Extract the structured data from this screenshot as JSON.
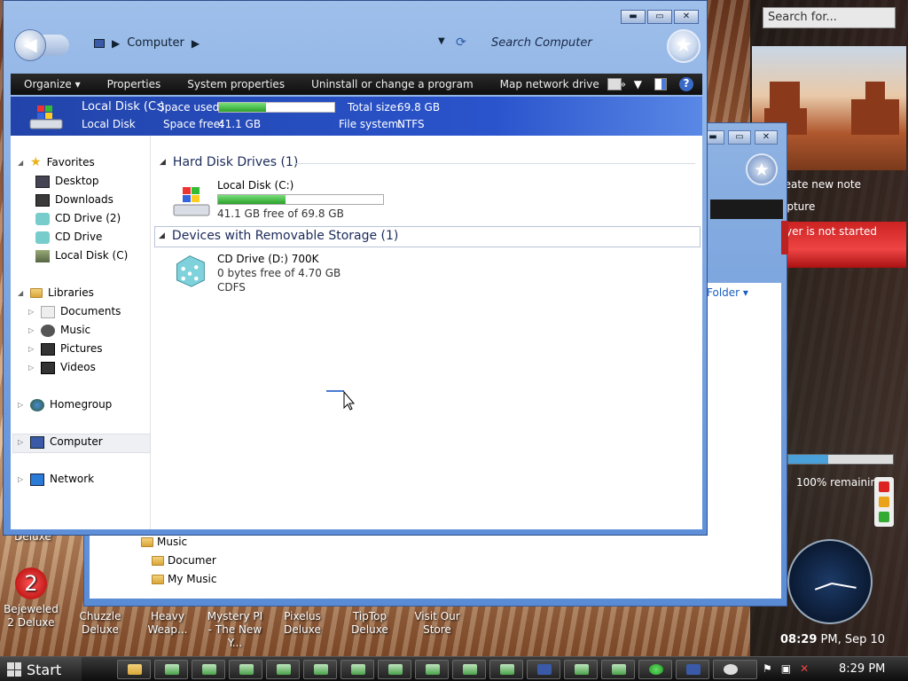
{
  "main_window": {
    "breadcrumb": [
      "Computer"
    ],
    "search_placeholder": "Search Computer",
    "window_controls": {
      "minimize": "▬",
      "maximize": "▭",
      "close": "✕"
    },
    "toolbar": {
      "organize": "Organize ▾",
      "properties": "Properties",
      "system_properties": "System properties",
      "uninstall": "Uninstall or change a program",
      "map_drive": "Map network drive",
      "more": "»"
    },
    "details": {
      "drive_name": "Local Disk (C:)",
      "drive_type": "Local Disk",
      "space_used_label": "Space used:",
      "space_used_fraction": 0.41,
      "space_free_label": "Space free:",
      "space_free_value": "41.1 GB",
      "total_size_label": "Total size:",
      "total_size_value": "69.8 GB",
      "file_system_label": "File system:",
      "file_system_value": "NTFS"
    },
    "nav": {
      "favorites": "Favorites",
      "desktop": "Desktop",
      "downloads": "Downloads",
      "cd_drive_2": "CD Drive (2)",
      "cd_drive": "CD Drive",
      "local_disk": "Local Disk (C)",
      "libraries": "Libraries",
      "documents": "Documents",
      "music": "Music",
      "pictures": "Pictures",
      "videos": "Videos",
      "homegroup": "Homegroup",
      "computer": "Computer",
      "network": "Network"
    },
    "groups": {
      "hard_disk": "Hard Disk Drives (1)",
      "removable": "Devices with Removable Storage (1)"
    },
    "local_disk_item": {
      "name": "Local Disk (C:)",
      "free_text": "41.1 GB free of 69.8 GB",
      "used_fraction": 0.41
    },
    "cd_item": {
      "name": "CD Drive (D:) 700K",
      "free_text": "0 bytes free of 4.70 GB",
      "fs": "CDFS"
    }
  },
  "back_window": {
    "folder_link": "Folder ▾",
    "tree": [
      "Music",
      "Documer",
      "My Music"
    ]
  },
  "gadgets": {
    "search_placeholder": "Search for...",
    "notes": [
      "reate new note",
      "apture"
    ],
    "media": "yer is not started",
    "battery": "100% remaining",
    "clock_time": "08:29",
    "clock_suffix": "PM, Sep 10"
  },
  "desktop_icons": [
    {
      "label": "Deluxe"
    },
    {
      "label": "Bejeweled 2 Deluxe"
    },
    {
      "label": "Chuzzle Deluxe"
    },
    {
      "label": "Heavy Weap..."
    },
    {
      "label": "Mystery PI - The New Y..."
    },
    {
      "label": "Pixelus Deluxe"
    },
    {
      "label": "TipTop Deluxe"
    },
    {
      "label": "Visit Our Store"
    }
  ],
  "taskbar": {
    "start_label": "Start",
    "time": "8:29 PM"
  },
  "colors": {
    "window_frame": "#5e8fd8",
    "toolbar_bg": "#111111",
    "details_bar": "#2a54cc",
    "link_blue": "#1a5fc0"
  }
}
